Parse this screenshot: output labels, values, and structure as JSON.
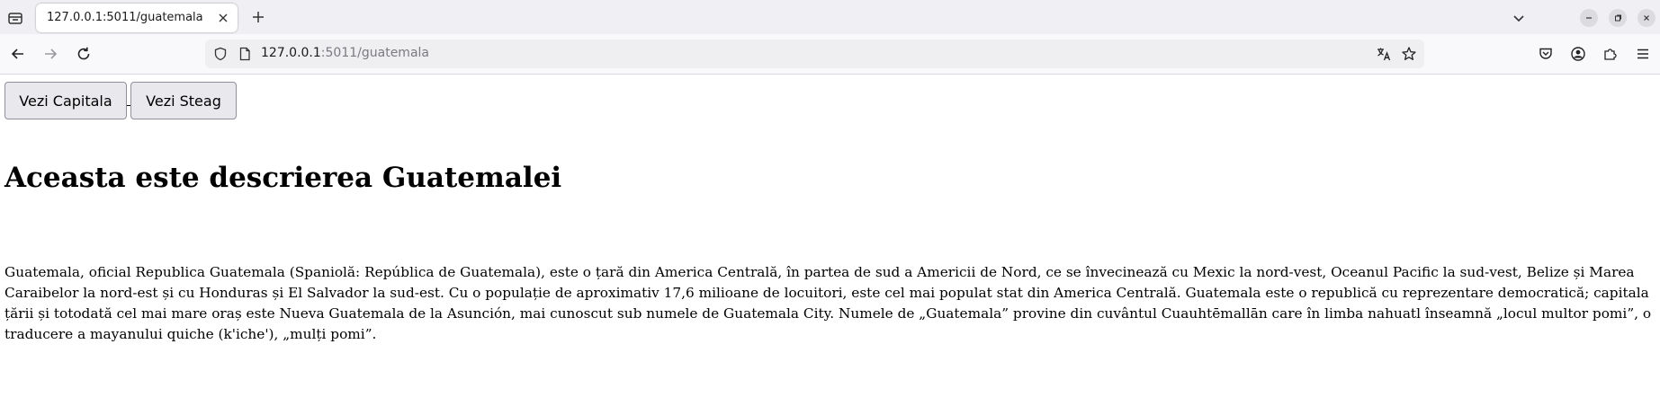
{
  "browser": {
    "tab": {
      "title": "127.0.0.1:5011/guatemala"
    },
    "url": {
      "host": "127.0.0.1",
      "path": ":5011/guatemala"
    }
  },
  "page": {
    "buttons": {
      "capitala": "Vezi Capitala",
      "steag": "Vezi Steag"
    },
    "heading": "Aceasta este descrierea Guatemalei",
    "description": "Guatemala, oficial Republica Guatemala (Spaniolă: República de Guatemala), este o țară din America Centrală, în partea de sud a Americii de Nord, ce se învecinează cu Mexic la nord-vest, Oceanul Pacific la sud-vest, Belize și Marea Caraibelor la nord-est și cu Honduras și El Salvador la sud-est. Cu o populație de aproximativ 17,6 milioane de locuitori, este cel mai populat stat din America Centrală. Guatemala este o republică cu reprezentare democratică; capitala țării și totodată cel mai mare oraș este Nueva Guatemala de la Asunción, mai cunoscut sub numele de Guatemala City. Numele de „Guatemala” provine din cuvântul Cuauhtēmallān care în limba nahuatl înseamnă „locul multor pomi”, o traducere a mayanului quiche (k'iche'), „mulți pomi”."
  },
  "icons": {
    "tab_list": "tab-list-icon",
    "close": "close-icon",
    "new_tab": "plus-icon",
    "list_tabs": "chevron-down-icon",
    "minimize": "minimize-icon",
    "restore": "restore-icon",
    "close_window": "close-window-icon",
    "back": "back-arrow-icon",
    "forward": "forward-arrow-icon",
    "reload": "reload-icon",
    "shield": "shield-icon",
    "page": "page-icon",
    "translate": "translate-icon",
    "bookmark": "star-icon",
    "pocket": "pocket-icon",
    "account": "account-icon",
    "extensions": "extensions-icon",
    "menu": "hamburger-menu-icon"
  }
}
